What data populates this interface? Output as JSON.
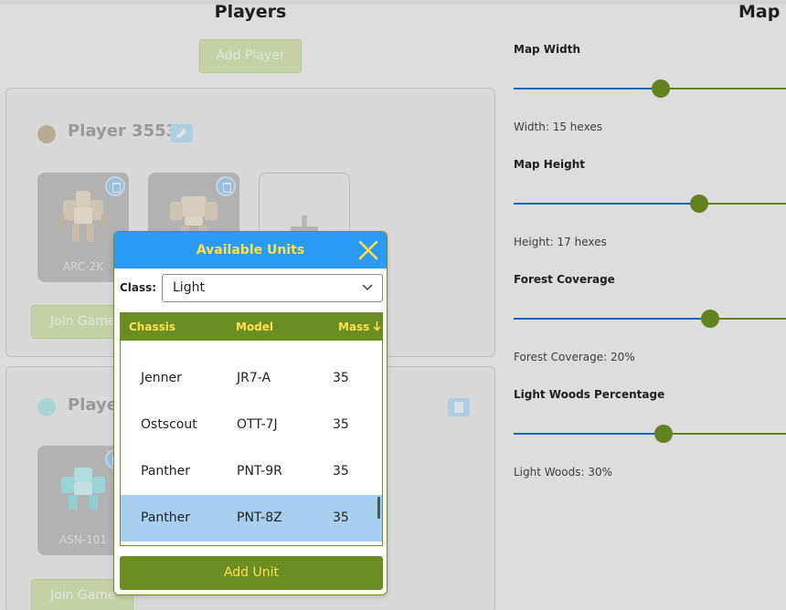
{
  "players": {
    "title": "Players",
    "add_player_label": "Add Player",
    "list": [
      {
        "name": "Player 3553",
        "color": "#c9b9a0",
        "units": [
          {
            "label": "ARC-2K"
          },
          {
            "label": ""
          }
        ],
        "join_label": "Join Game"
      },
      {
        "name": "Playe",
        "color": "#b8e8ea",
        "units": [
          {
            "label": "ASN-101"
          }
        ],
        "join_label": "Join Game"
      }
    ]
  },
  "map": {
    "title": "Map",
    "sliders": [
      {
        "label": "Map Width",
        "value_text": "Width: 15 hexes",
        "fraction": 0.54
      },
      {
        "label": "Map Height",
        "value_text": "Height: 17 hexes",
        "fraction": 0.68
      },
      {
        "label": "Forest Coverage",
        "value_text": "Forest Coverage: 20%",
        "fraction": 0.72
      },
      {
        "label": "Light Woods Percentage",
        "value_text": "Light Woods: 30%",
        "fraction": 0.55
      }
    ]
  },
  "modal": {
    "title": "Available Units",
    "class_label": "Class:",
    "class_value": "Light",
    "columns": [
      "Chassis",
      "Model",
      "Mass"
    ],
    "sort_indicator": "↓",
    "rows": [
      {
        "chassis": "Jenner",
        "model": "JR7-A",
        "mass": "35",
        "selected": false
      },
      {
        "chassis": "Ostscout",
        "model": "OTT-7J",
        "mass": "35",
        "selected": false
      },
      {
        "chassis": "Panther",
        "model": "PNT-9R",
        "mass": "35",
        "selected": false
      },
      {
        "chassis": "Panther",
        "model": "PNT-8Z",
        "mass": "35",
        "selected": true
      }
    ],
    "add_unit_label": "Add Unit"
  },
  "colors": {
    "accent_blue": "#2b9af3",
    "olive": "#6b8e23",
    "title_yellow": "#ffe04d",
    "slider_blue": "#1c6fc7"
  }
}
